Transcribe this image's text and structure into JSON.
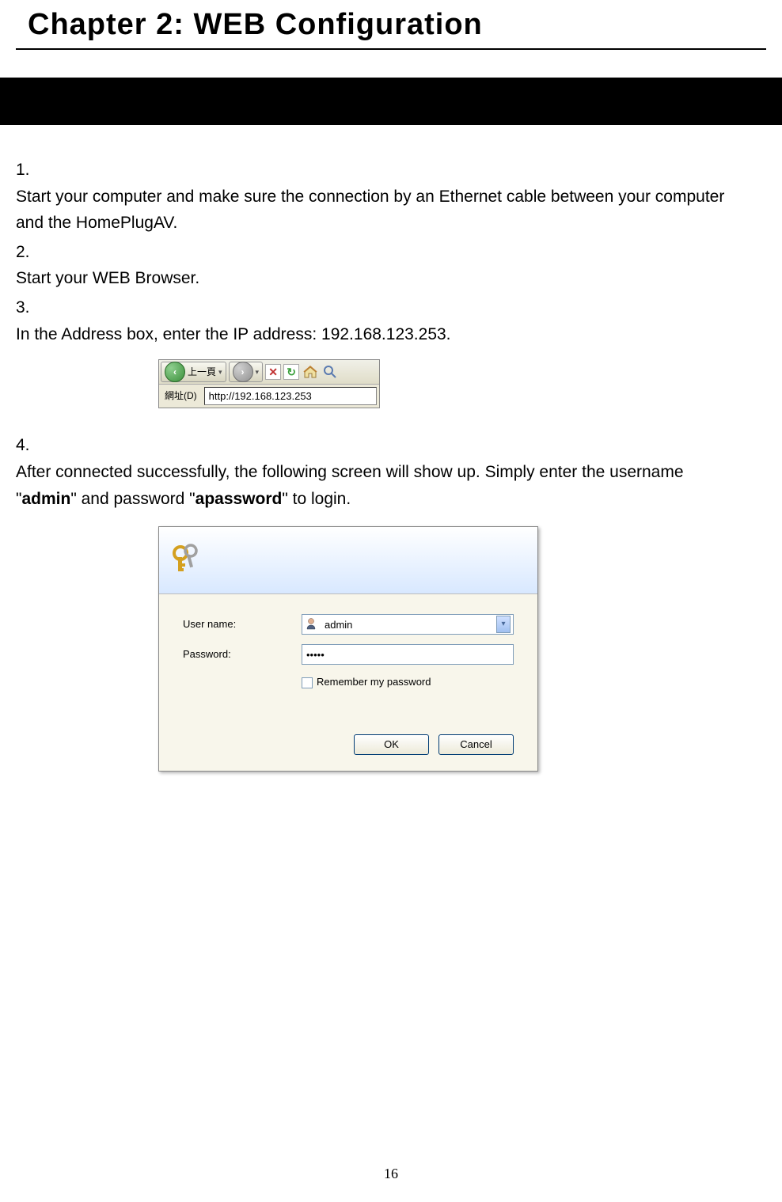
{
  "chapter_title": "Chapter 2: WEB Configuration",
  "steps": {
    "item1_num": "1.",
    "item1_text": "Start your computer and make sure the connection by an Ethernet cable between your computer and the HomePlugAV.",
    "item2_num": "2.",
    "item2_text": "Start your WEB Browser.",
    "item3_num": "3.",
    "item3_text": "In the Address box, enter the IP address: 192.168.123.253.",
    "item4_num": "4.",
    "item4_text_a": "After connected successfully, the following screen will show up. Simply enter the username \"",
    "item4_bold_a": "admin",
    "item4_text_b": "\" and password \"",
    "item4_bold_b": "apassword",
    "item4_text_c": "\" to login."
  },
  "toolbar": {
    "back_label": "上一頁",
    "back_arrow": "‹",
    "fwd_arrow": "›",
    "dropdown": "▾",
    "stop": "✕",
    "refresh": "↻",
    "address_label": "網址(D)",
    "address_value": "http://192.168.123.253"
  },
  "auth": {
    "username_label": "User name:",
    "username_value": "admin",
    "password_label": "Password:",
    "password_value": "•••••",
    "remember_label": "Remember my password",
    "ok_label": "OK",
    "cancel_label": "Cancel",
    "dropdown_glyph": "▾"
  },
  "page_number": "16"
}
